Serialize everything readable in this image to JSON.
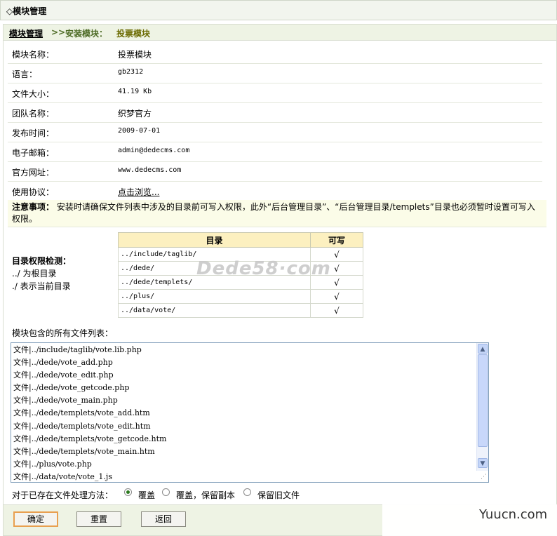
{
  "header": {
    "title": "◇模块管理"
  },
  "breadcrumb": {
    "root": "模块管理",
    "sep": ">>",
    "step": "安装模块：",
    "current": "投票模块"
  },
  "info": [
    {
      "label": "模块名称：",
      "value": "投票模块"
    },
    {
      "label": "语言：",
      "value": "gb2312"
    },
    {
      "label": "文件大小：",
      "value": "41.19 Kb"
    },
    {
      "label": "团队名称：",
      "value": "织梦官方"
    },
    {
      "label": "发布时间：",
      "value": "2009-07-01"
    },
    {
      "label": "电子邮箱：",
      "value": "admin@dedecms.com"
    },
    {
      "label": "官方网址：",
      "value": "www.dedecms.com"
    },
    {
      "label": "使用协议：",
      "value": "点击浏览..."
    }
  ],
  "notice": {
    "label": "注意事项：",
    "text": "安装时请确保文件列表中涉及的目录前可写入权限，此外“后台管理目录”、“后台管理目录/templets”目录也必须暂时设置可写入权限。"
  },
  "permissions": {
    "title": "目录权限检测：",
    "hint1": "../ 为根目录",
    "hint2": "./ 表示当前目录",
    "col_dir": "目录",
    "col_writable": "可写",
    "rows": [
      {
        "dir": "../include/taglib/",
        "writable": "√"
      },
      {
        "dir": "../dede/",
        "writable": "√"
      },
      {
        "dir": "../dede/templets/",
        "writable": "√"
      },
      {
        "dir": "../plus/",
        "writable": "√"
      },
      {
        "dir": "../data/vote/",
        "writable": "√"
      }
    ]
  },
  "watermark": "Dede58·com",
  "files": {
    "label": "模块包含的所有文件列表：",
    "lines": [
      "文件|../include/taglib/vote.lib.php",
      "文件|../dede/vote_add.php",
      "文件|../dede/vote_edit.php",
      "文件|../dede/vote_getcode.php",
      "文件|../dede/vote_main.php",
      "文件|../dede/templets/vote_add.htm",
      "文件|../dede/templets/vote_edit.htm",
      "文件|../dede/templets/vote_getcode.htm",
      "文件|../dede/templets/vote_main.htm",
      "文件|../plus/vote.php",
      "文件|../data/vote/vote_1.js"
    ]
  },
  "method": {
    "question": "对于已存在文件处理方法：",
    "options": [
      "覆盖",
      "覆盖，保留副本",
      "保留旧文件"
    ],
    "selected": "覆盖"
  },
  "buttons": {
    "ok": "确定",
    "reset": "重置",
    "back": "返回"
  },
  "brand": "Yuucn.com"
}
